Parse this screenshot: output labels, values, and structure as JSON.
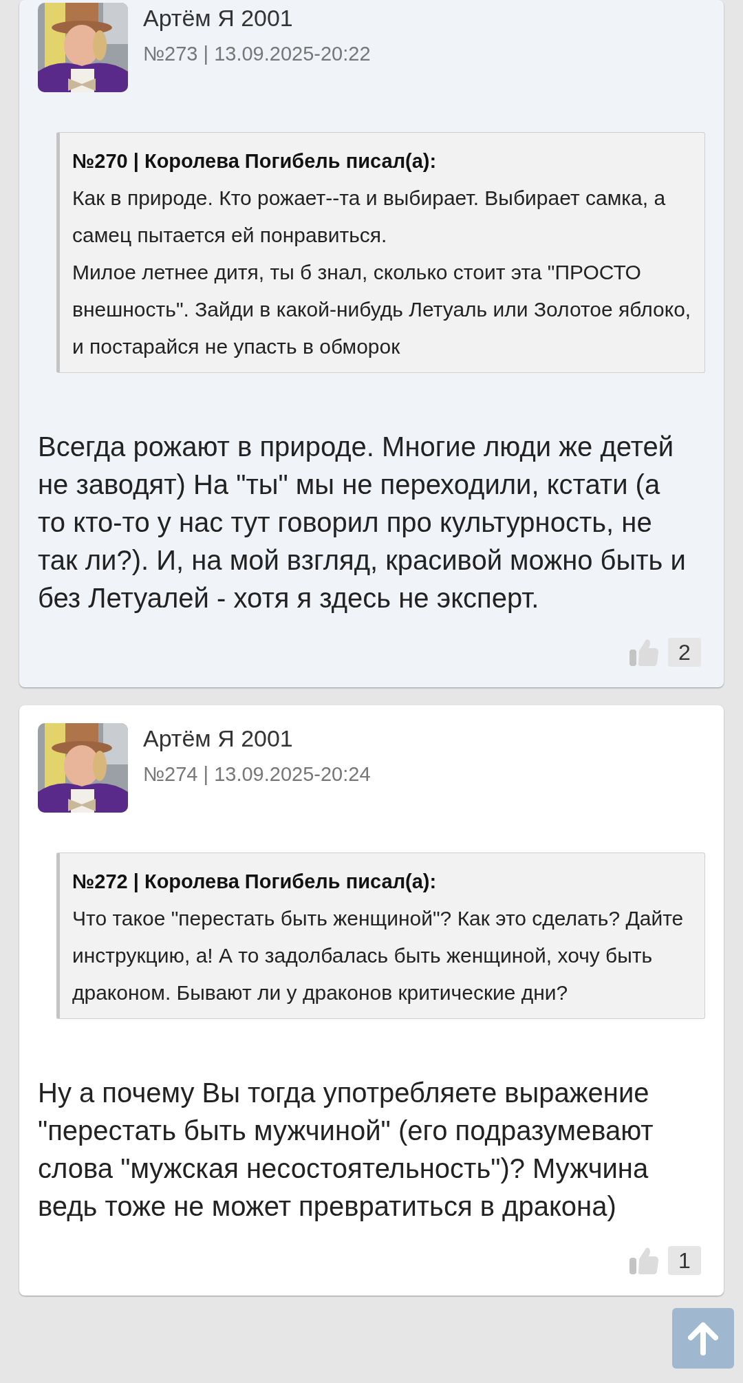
{
  "posts": [
    {
      "highlighted": true,
      "author": "Артём Я 2001",
      "meta": "№273 | 13.09.2025-20:22",
      "quote": {
        "header": "№270 | Королева Погибель писал(а):",
        "paragraphs": [
          "Как в природе. Кто рожает--та и выбирает. Выбирает самка, а самец пытается ей понравиться.",
          "Милое летнее дитя, ты б знал, сколько стоит эта \"ПРОСТО внешность\". Зайди в какой-нибудь Летуаль или Золотое яблоко, и постарайся не упасть в обморок"
        ]
      },
      "text": "Всегда рожают в природе. Многие люди же детей не заводят) На \"ты\" мы не переходили, кстати (а то кто-то у нас тут говорил про культурность, не так ли?). И, на мой взгляд, красивой можно быть и без Летуалей - хотя я здесь не эксперт.",
      "likes": "2"
    },
    {
      "highlighted": false,
      "author": "Артём Я 2001",
      "meta": "№274 | 13.09.2025-20:24",
      "quote": {
        "header": "№272 | Королева Погибель писал(а):",
        "paragraphs": [
          "Что такое \"перестать быть женщиной\"? Как это сделать? Дайте инструкцию, а! А то задолбалась быть женщиной, хочу быть драконом. Бывают ли у драконов критические дни?"
        ]
      },
      "text": "Ну а почему Вы тогда употребляете выражение \"перестать быть мужчиной\" (его подразумевают слова \"мужская несостоятельность\")? Мужчина ведь тоже не может превратиться в дракона)",
      "likes": "1"
    }
  ]
}
